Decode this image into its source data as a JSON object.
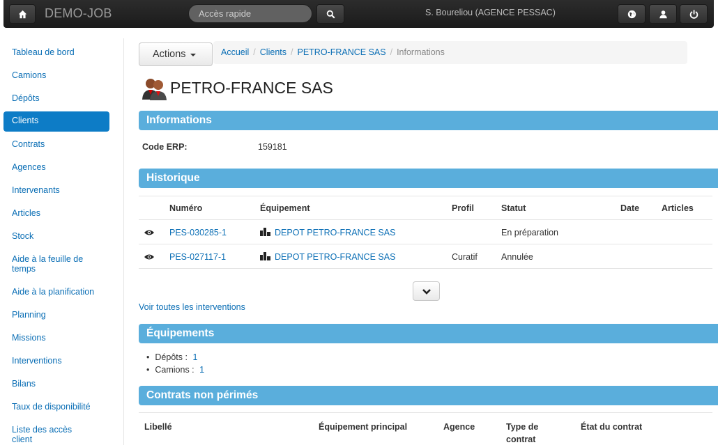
{
  "navbar": {
    "brand": "DEMO-JOB",
    "quick_access_placeholder": "Accès rapide",
    "user": "S. Boureliou (AGENCE PESSAC)",
    "icons": [
      "home-icon",
      "search-icon",
      "globe-icon",
      "user-icon",
      "power-icon"
    ]
  },
  "sidebar": {
    "items": [
      {
        "label": "Tableau de bord"
      },
      {
        "label": "Camions"
      },
      {
        "label": "Dépôts"
      },
      {
        "label": "Clients"
      },
      {
        "label": "Contrats"
      },
      {
        "label": "Agences"
      },
      {
        "label": "Intervenants"
      },
      {
        "label": "Articles"
      },
      {
        "label": "Stock"
      },
      {
        "label": "Aide à la feuille de temps"
      },
      {
        "label": "Aide à la planification"
      },
      {
        "label": "Planning"
      },
      {
        "label": "Missions"
      },
      {
        "label": "Interventions"
      },
      {
        "label": "Bilans"
      },
      {
        "label": "Taux de disponibilité"
      },
      {
        "label": "Liste des accès client"
      }
    ],
    "active": "Clients"
  },
  "toolbar": {
    "actions_label": "Actions"
  },
  "breadcrumb": {
    "items": [
      "Accueil",
      "Clients",
      "PETRO-FRANCE SAS"
    ],
    "current": "Informations"
  },
  "page": {
    "title": "PETRO-FRANCE SAS"
  },
  "informations": {
    "title": "Informations",
    "code_erp_label": "Code ERP:",
    "code_erp_value": "159181"
  },
  "historique": {
    "title": "Historique",
    "columns": [
      "Numéro",
      "Équipement",
      "Profil",
      "Statut",
      "Date",
      "Articles"
    ],
    "rows": [
      {
        "numero": "PES-030285-1",
        "equipement": "DEPOT PETRO-FRANCE SAS",
        "profil": "",
        "statut": "En préparation",
        "date": "",
        "articles": ""
      },
      {
        "numero": "PES-027117-1",
        "equipement": "DEPOT PETRO-FRANCE SAS",
        "profil": "Curatif",
        "statut": "Annulée",
        "date": "",
        "articles": ""
      }
    ],
    "see_all": "Voir toutes les interventions"
  },
  "equipements": {
    "title": "Équipements",
    "items": [
      {
        "label": "Dépôts :",
        "count": "1"
      },
      {
        "label": "Camions :",
        "count": "1"
      }
    ]
  },
  "contrats": {
    "title": "Contrats non périmés",
    "columns": [
      "Libellé",
      "Équipement principal",
      "Agence",
      "Type de contrat",
      "État du contrat"
    ]
  },
  "colors": {
    "accent": "#0d7cc6",
    "section": "#5aaedc",
    "link": "#0a6eb5",
    "navbar": "#222222"
  }
}
